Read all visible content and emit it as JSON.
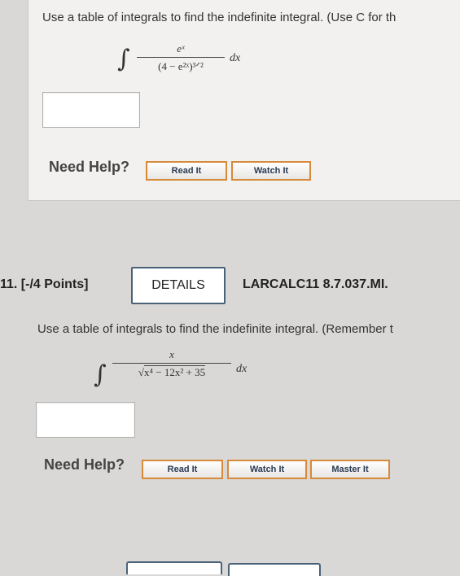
{
  "question_prev": {
    "prompt": "Use a table of integrals to find the indefinite integral. (Use C for th",
    "integrand": {
      "integral_symbol": "∫",
      "numerator": "eˣ",
      "denominator": "(4 − e²ˣ)³ᐟ²",
      "differential": "dx"
    },
    "answer_value": "",
    "need_help_label": "Need Help?",
    "read_it_label": "Read It",
    "watch_it_label": "Watch It"
  },
  "question_11": {
    "number_points": "11. [-/4 Points]",
    "details_label": "DETAILS",
    "course_code": "LARCALC11 8.7.037.MI.",
    "prompt": "Use a table of integrals to find the indefinite integral. (Remember t",
    "integrand": {
      "integral_symbol": "∫",
      "numerator": "x",
      "radical_symbol": "√",
      "denominator": "x⁴ − 12x² + 35",
      "differential": "dx"
    },
    "answer_value": "",
    "need_help_label": "Need Help?",
    "read_it_label": "Read It",
    "watch_it_label": "Watch It",
    "master_it_label": "Master It"
  }
}
